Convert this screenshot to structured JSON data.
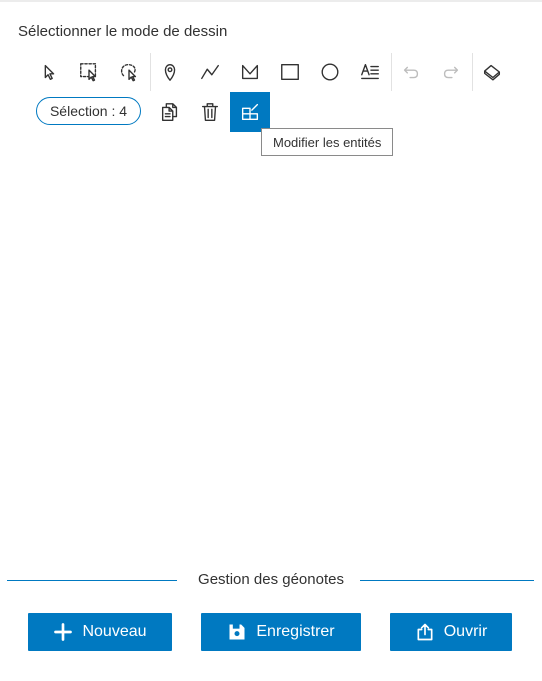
{
  "panel": {
    "heading": "Sélectionner le mode de dessin"
  },
  "toolbar": {
    "tools": [
      {
        "name": "select",
        "icon": "select-arrow-icon",
        "state": "enabled"
      },
      {
        "name": "select-rectangle",
        "icon": "select-rectangle-icon",
        "state": "enabled"
      },
      {
        "name": "select-lasso",
        "icon": "select-lasso-icon",
        "state": "enabled"
      },
      {
        "name": "point",
        "icon": "pin-icon",
        "state": "enabled"
      },
      {
        "name": "polyline",
        "icon": "polyline-icon",
        "state": "enabled"
      },
      {
        "name": "polygon",
        "icon": "polygon-icon",
        "state": "enabled"
      },
      {
        "name": "rectangle",
        "icon": "rectangle-icon",
        "state": "enabled"
      },
      {
        "name": "circle",
        "icon": "circle-icon",
        "state": "enabled"
      },
      {
        "name": "text",
        "icon": "text-icon",
        "state": "enabled"
      },
      {
        "name": "undo",
        "icon": "undo-icon",
        "state": "disabled"
      },
      {
        "name": "redo",
        "icon": "redo-icon",
        "state": "disabled"
      },
      {
        "name": "erase",
        "icon": "eraser-icon",
        "state": "enabled"
      },
      {
        "name": "duplicate",
        "icon": "copy-icon",
        "state": "enabled"
      },
      {
        "name": "delete",
        "icon": "trash-icon",
        "state": "enabled"
      },
      {
        "name": "edit",
        "icon": "edit-features-icon",
        "state": "active"
      }
    ],
    "selection_label": "Sélection : 4",
    "tooltip": "Modifier les entités"
  },
  "section": {
    "title": "Gestion des géonotes"
  },
  "actions": [
    {
      "label": "Nouveau",
      "icon": "plus-icon"
    },
    {
      "label": "Enregistrer",
      "icon": "save-icon"
    },
    {
      "label": "Ouvrir",
      "icon": "share-icon"
    }
  ],
  "colors": {
    "accent": "#0079c1",
    "text": "#323232",
    "disabled": "#bdbdbd"
  }
}
